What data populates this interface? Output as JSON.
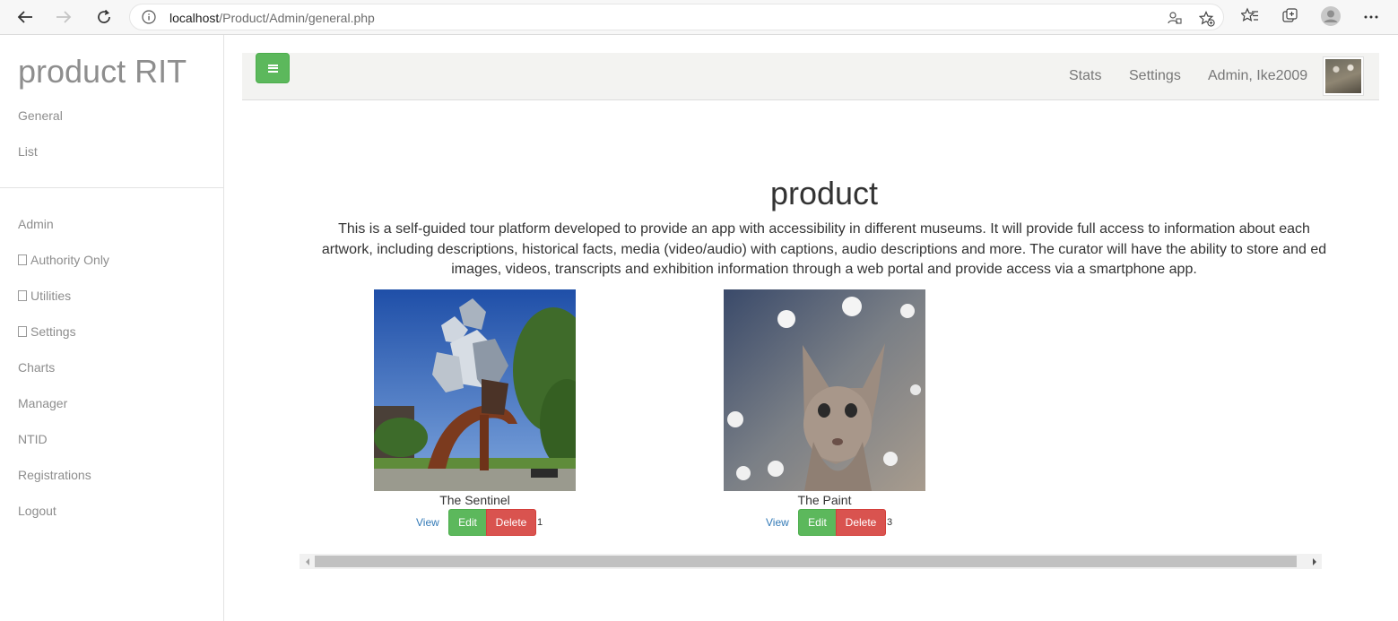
{
  "browser": {
    "url_host": "localhost",
    "url_path": "/Product/Admin/general.php"
  },
  "sidebar": {
    "brand": "product RIT",
    "top_items": [
      {
        "label": "General"
      },
      {
        "label": "List"
      }
    ],
    "items": [
      {
        "label": "Admin"
      },
      {
        "label": "Authority Only"
      },
      {
        "label": "Utilities"
      },
      {
        "label": "Settings"
      },
      {
        "label": "Charts"
      },
      {
        "label": "Manager"
      },
      {
        "label": "NTID"
      },
      {
        "label": "Registrations"
      },
      {
        "label": "Logout"
      }
    ]
  },
  "topbar": {
    "stats": "Stats",
    "settings": "Settings",
    "user": "Admin, Ike2009"
  },
  "main": {
    "title": "product",
    "description_lines": [
      "This is a self-guided tour platform developed to provide an app with accessibility in different museums. It will provide full access to information about each",
      "artwork, including descriptions, historical facts, media (video/audio) with captions, audio descriptions and more. The curator will have the ability to store and ed",
      "images, videos, transcripts and exhibition information through a web portal and provide access via a smartphone app."
    ],
    "cards": [
      {
        "title": "The Sentinel",
        "view": "View",
        "edit": "Edit",
        "delete": "Delete",
        "id": "1"
      },
      {
        "title": "The Paint",
        "view": "View",
        "edit": "Edit",
        "delete": "Delete",
        "id": "3"
      }
    ]
  },
  "colors": {
    "edit": "#5cb85c",
    "delete": "#d9534f",
    "link": "#337ab7"
  }
}
